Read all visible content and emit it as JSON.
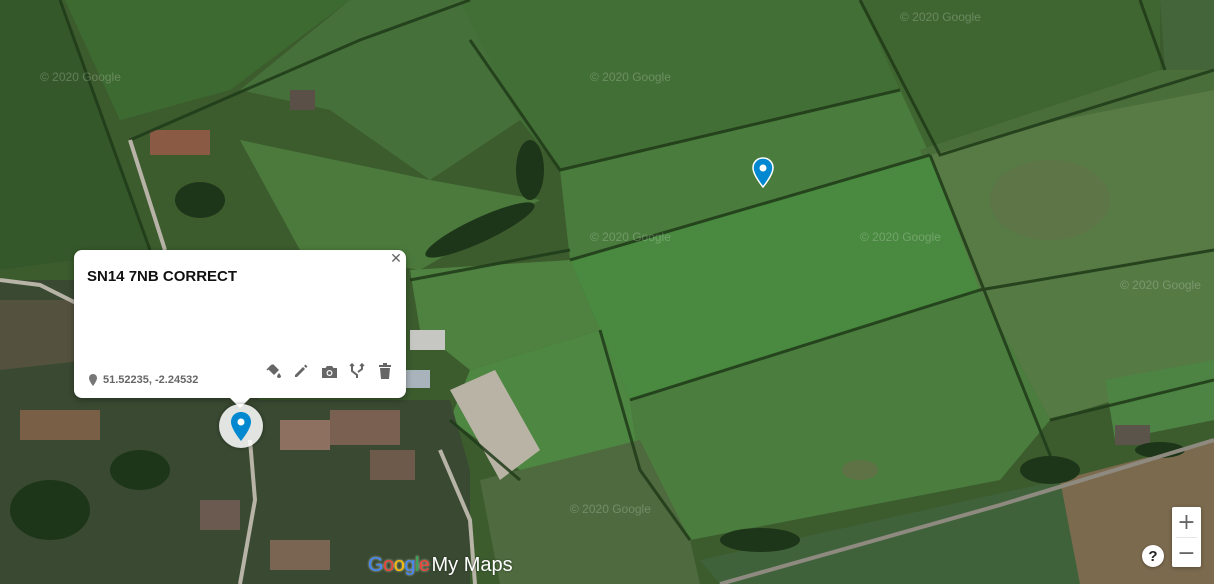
{
  "map": {
    "type": "satellite",
    "watermark": "© 2020 Google"
  },
  "markers": [
    {
      "name": "field-marker",
      "color": "#0288d1"
    },
    {
      "name": "selected-marker",
      "color": "#0288d1",
      "selected": true
    }
  ],
  "info_window": {
    "title": "SN14 7NB CORRECT",
    "coordinates": "51.52235, -2.24532",
    "tools": [
      "paint-bucket-icon",
      "pencil-icon",
      "camera-icon",
      "directions-icon",
      "trash-icon"
    ]
  },
  "branding": {
    "google": [
      {
        "ch": "G",
        "color": "#4285F4"
      },
      {
        "ch": "o",
        "color": "#EA4335"
      },
      {
        "ch": "o",
        "color": "#FBBC05"
      },
      {
        "ch": "g",
        "color": "#4285F4"
      },
      {
        "ch": "l",
        "color": "#34A853"
      },
      {
        "ch": "e",
        "color": "#EA4335"
      }
    ],
    "product": "My Maps"
  },
  "controls": {
    "zoom_in": "+",
    "zoom_out": "−",
    "help": "?"
  }
}
